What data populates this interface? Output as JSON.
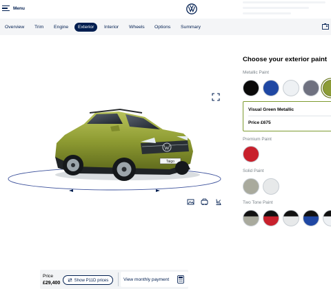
{
  "header": {
    "menu_label": "Menu",
    "logo_icon": "vw-logo-icon"
  },
  "nav": {
    "tabs": [
      {
        "label": "Overview",
        "active": false
      },
      {
        "label": "Trim",
        "active": false
      },
      {
        "label": "Engine",
        "active": false
      },
      {
        "label": "Exterior",
        "active": true
      },
      {
        "label": "Interior",
        "active": false
      },
      {
        "label": "Wheels",
        "active": false
      },
      {
        "label": "Options",
        "active": false
      },
      {
        "label": "Summary",
        "active": false
      }
    ],
    "config_icon": "configuration-icon"
  },
  "viewer": {
    "car_badge": "Taigo",
    "icons": [
      "fullscreen-icon",
      "gallery-icon",
      "interior-view-icon",
      "seat-view-icon"
    ]
  },
  "panel": {
    "title": "Choose your exterior paint",
    "sections": {
      "metallic": {
        "label": "Metallic Paint",
        "colors": [
          "#0a0a0a",
          "#1f47a3",
          "#eef1f4",
          "#6f7180",
          "#8c9c36"
        ],
        "selected_index": 4
      },
      "premium": {
        "label": "Premium Paint",
        "colors": [
          "#c8202c"
        ]
      },
      "solid": {
        "label": "Solid Paint",
        "colors": [
          "#a9aa9d",
          "#e7e9ea"
        ]
      },
      "two_tone": {
        "label": "Two Tone Paint",
        "swatches": [
          {
            "body": "#a9aa9d",
            "roof": "#111111"
          },
          {
            "body": "#c8202c",
            "roof": "#111111"
          },
          {
            "body": "#e7e9ea",
            "roof": "#111111"
          },
          {
            "body": "#1f47a3",
            "roof": "#111111"
          },
          {
            "body": "#eef1f4",
            "roof": "#111111"
          }
        ]
      }
    },
    "selected": {
      "name": "Visual Green Metallic",
      "price": "Price £675"
    }
  },
  "price_bar": {
    "label": "Price",
    "value": "£29,400",
    "p11d_button": "Show P11D prices",
    "monthly_button": "View monthly payment"
  }
}
